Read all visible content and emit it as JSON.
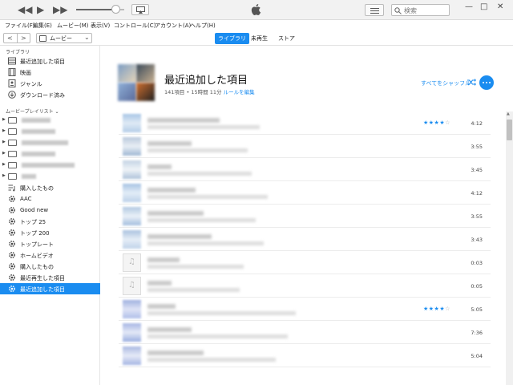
{
  "player": {
    "volume_fraction": 0.75
  },
  "search": {
    "placeholder": "検索"
  },
  "window_controls": {
    "minimize": "—",
    "maximize": "□",
    "close": "✕"
  },
  "menu": [
    "ファイル(F)",
    "編集(E)",
    "ムービー(M)",
    "表示(V)",
    "コントロール(C)",
    "アカウント(A)",
    "ヘルプ(H)"
  ],
  "nav": {
    "back": "<",
    "forward": ">",
    "media_selector": "ムービー",
    "tabs": [
      {
        "label": "ライブラリ",
        "active": true
      },
      {
        "label": "未再生",
        "active": false
      },
      {
        "label": "ストア",
        "active": false
      }
    ]
  },
  "sidebar": {
    "library_header": "ライブラリ",
    "library_items": [
      {
        "label": "最近追加した項目",
        "icon": "recent-grid-icon"
      },
      {
        "label": "映画",
        "icon": "film-icon"
      },
      {
        "label": "ジャンル",
        "icon": "genre-icon"
      },
      {
        "label": "ダウンロード済み",
        "icon": "download-icon"
      }
    ],
    "playlists_header": "ムービープレイリスト",
    "playlist_items": [
      {
        "label": "購入したもの",
        "icon": "purchased-list-icon"
      },
      {
        "label": "AAC",
        "icon": "smart-playlist-gear-icon"
      },
      {
        "label": "Good new",
        "icon": "smart-playlist-gear-icon"
      },
      {
        "label": "トップ 25",
        "icon": "smart-playlist-gear-icon"
      },
      {
        "label": "トップ 200",
        "icon": "smart-playlist-gear-icon"
      },
      {
        "label": "トップレート",
        "icon": "smart-playlist-gear-icon"
      },
      {
        "label": "ホームビデオ",
        "icon": "smart-playlist-gear-icon"
      },
      {
        "label": "購入したもの",
        "icon": "smart-playlist-gear-icon"
      },
      {
        "label": "最近再生した項目",
        "icon": "smart-playlist-gear-icon"
      },
      {
        "label": "最近追加した項目",
        "icon": "smart-playlist-gear-icon",
        "selected": true
      }
    ]
  },
  "main": {
    "title": "最近追加した項目",
    "summary": "141項目 • 15時間 11分",
    "edit_rules": "ルールを編集",
    "shuffle_all": "すべてをシャッフル",
    "colors": {
      "accent": "#1a8cf0"
    }
  },
  "tracks": [
    {
      "duration": "4:12",
      "rating": 4
    },
    {
      "duration": "3:55",
      "rating": null
    },
    {
      "duration": "3:45",
      "rating": null
    },
    {
      "duration": "4:12",
      "rating": null
    },
    {
      "duration": "3:55",
      "rating": null
    },
    {
      "duration": "3:43",
      "rating": null
    },
    {
      "duration": "0:03",
      "rating": null
    },
    {
      "duration": "0:05",
      "rating": null
    },
    {
      "duration": "5:05",
      "rating": 4
    },
    {
      "duration": "7:36",
      "rating": null
    },
    {
      "duration": "5:04",
      "rating": null
    }
  ]
}
